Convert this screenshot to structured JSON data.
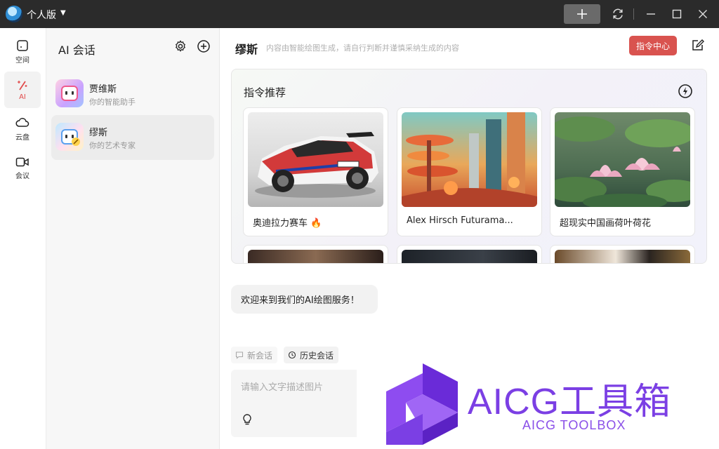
{
  "titlebar": {
    "title": "个人版"
  },
  "rail": {
    "items": [
      {
        "label": "空间",
        "icon": "square-icon"
      },
      {
        "label": "AI",
        "icon": "magic-wand-icon",
        "active": true
      },
      {
        "label": "云盘",
        "icon": "cloud-icon"
      },
      {
        "label": "会议",
        "icon": "video-icon"
      }
    ]
  },
  "conversations": {
    "title": "AI 会话",
    "items": [
      {
        "name": "贾维斯",
        "subtitle": "你的智能助手"
      },
      {
        "name": "缪斯",
        "subtitle": "你的艺术专家",
        "active": true
      }
    ]
  },
  "main": {
    "title": "缪斯",
    "description": "内容由智能绘图生成，请自行判断并谨慎采纳生成的内容",
    "command_center": "指令中心",
    "recommend": {
      "title": "指令推荐",
      "cards": [
        {
          "caption": "奥迪拉力赛车",
          "hot": true
        },
        {
          "caption": "Alex Hirsch Futurama..."
        },
        {
          "caption": "超现实中国画荷叶荷花"
        }
      ]
    },
    "welcome": "欢迎来到我们的AI绘图服务！",
    "chips": {
      "new": "新会话",
      "history": "历史会话"
    },
    "input": {
      "placeholder": "请输入文字描述图片"
    }
  },
  "watermark": {
    "text": "AICG工具箱",
    "sub": "AICG TOOLBOX",
    "color": "#7b3fe4"
  },
  "colors": {
    "accent": "#d9534f",
    "active_text": "#e14b4b"
  }
}
